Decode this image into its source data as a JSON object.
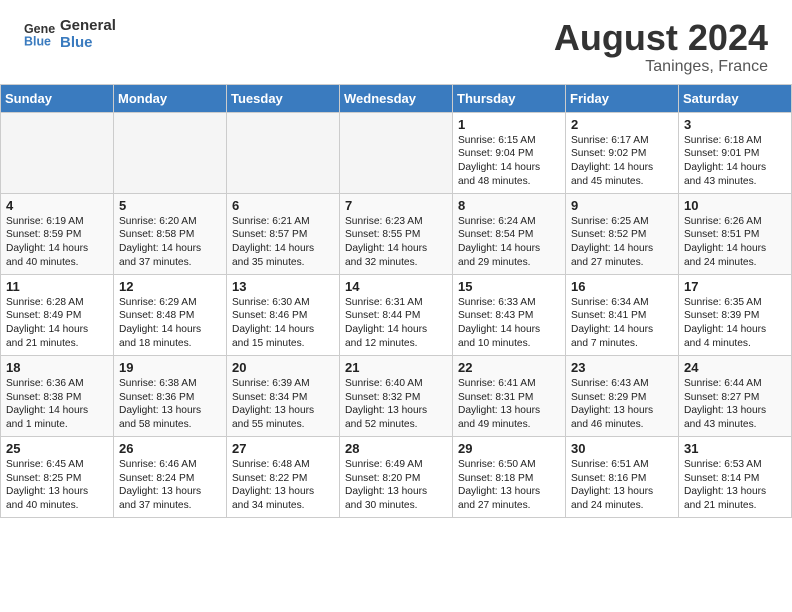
{
  "header": {
    "logo_line1": "General",
    "logo_line2": "Blue",
    "month_year": "August 2024",
    "location": "Taninges, France"
  },
  "days_of_week": [
    "Sunday",
    "Monday",
    "Tuesday",
    "Wednesday",
    "Thursday",
    "Friday",
    "Saturday"
  ],
  "weeks": [
    [
      {
        "day": "",
        "content": ""
      },
      {
        "day": "",
        "content": ""
      },
      {
        "day": "",
        "content": ""
      },
      {
        "day": "",
        "content": ""
      },
      {
        "day": "1",
        "content": "Sunrise: 6:15 AM\nSunset: 9:04 PM\nDaylight: 14 hours\nand 48 minutes."
      },
      {
        "day": "2",
        "content": "Sunrise: 6:17 AM\nSunset: 9:02 PM\nDaylight: 14 hours\nand 45 minutes."
      },
      {
        "day": "3",
        "content": "Sunrise: 6:18 AM\nSunset: 9:01 PM\nDaylight: 14 hours\nand 43 minutes."
      }
    ],
    [
      {
        "day": "4",
        "content": "Sunrise: 6:19 AM\nSunset: 8:59 PM\nDaylight: 14 hours\nand 40 minutes."
      },
      {
        "day": "5",
        "content": "Sunrise: 6:20 AM\nSunset: 8:58 PM\nDaylight: 14 hours\nand 37 minutes."
      },
      {
        "day": "6",
        "content": "Sunrise: 6:21 AM\nSunset: 8:57 PM\nDaylight: 14 hours\nand 35 minutes."
      },
      {
        "day": "7",
        "content": "Sunrise: 6:23 AM\nSunset: 8:55 PM\nDaylight: 14 hours\nand 32 minutes."
      },
      {
        "day": "8",
        "content": "Sunrise: 6:24 AM\nSunset: 8:54 PM\nDaylight: 14 hours\nand 29 minutes."
      },
      {
        "day": "9",
        "content": "Sunrise: 6:25 AM\nSunset: 8:52 PM\nDaylight: 14 hours\nand 27 minutes."
      },
      {
        "day": "10",
        "content": "Sunrise: 6:26 AM\nSunset: 8:51 PM\nDaylight: 14 hours\nand 24 minutes."
      }
    ],
    [
      {
        "day": "11",
        "content": "Sunrise: 6:28 AM\nSunset: 8:49 PM\nDaylight: 14 hours\nand 21 minutes."
      },
      {
        "day": "12",
        "content": "Sunrise: 6:29 AM\nSunset: 8:48 PM\nDaylight: 14 hours\nand 18 minutes."
      },
      {
        "day": "13",
        "content": "Sunrise: 6:30 AM\nSunset: 8:46 PM\nDaylight: 14 hours\nand 15 minutes."
      },
      {
        "day": "14",
        "content": "Sunrise: 6:31 AM\nSunset: 8:44 PM\nDaylight: 14 hours\nand 12 minutes."
      },
      {
        "day": "15",
        "content": "Sunrise: 6:33 AM\nSunset: 8:43 PM\nDaylight: 14 hours\nand 10 minutes."
      },
      {
        "day": "16",
        "content": "Sunrise: 6:34 AM\nSunset: 8:41 PM\nDaylight: 14 hours\nand 7 minutes."
      },
      {
        "day": "17",
        "content": "Sunrise: 6:35 AM\nSunset: 8:39 PM\nDaylight: 14 hours\nand 4 minutes."
      }
    ],
    [
      {
        "day": "18",
        "content": "Sunrise: 6:36 AM\nSunset: 8:38 PM\nDaylight: 14 hours\nand 1 minute."
      },
      {
        "day": "19",
        "content": "Sunrise: 6:38 AM\nSunset: 8:36 PM\nDaylight: 13 hours\nand 58 minutes."
      },
      {
        "day": "20",
        "content": "Sunrise: 6:39 AM\nSunset: 8:34 PM\nDaylight: 13 hours\nand 55 minutes."
      },
      {
        "day": "21",
        "content": "Sunrise: 6:40 AM\nSunset: 8:32 PM\nDaylight: 13 hours\nand 52 minutes."
      },
      {
        "day": "22",
        "content": "Sunrise: 6:41 AM\nSunset: 8:31 PM\nDaylight: 13 hours\nand 49 minutes."
      },
      {
        "day": "23",
        "content": "Sunrise: 6:43 AM\nSunset: 8:29 PM\nDaylight: 13 hours\nand 46 minutes."
      },
      {
        "day": "24",
        "content": "Sunrise: 6:44 AM\nSunset: 8:27 PM\nDaylight: 13 hours\nand 43 minutes."
      }
    ],
    [
      {
        "day": "25",
        "content": "Sunrise: 6:45 AM\nSunset: 8:25 PM\nDaylight: 13 hours\nand 40 minutes."
      },
      {
        "day": "26",
        "content": "Sunrise: 6:46 AM\nSunset: 8:24 PM\nDaylight: 13 hours\nand 37 minutes."
      },
      {
        "day": "27",
        "content": "Sunrise: 6:48 AM\nSunset: 8:22 PM\nDaylight: 13 hours\nand 34 minutes."
      },
      {
        "day": "28",
        "content": "Sunrise: 6:49 AM\nSunset: 8:20 PM\nDaylight: 13 hours\nand 30 minutes."
      },
      {
        "day": "29",
        "content": "Sunrise: 6:50 AM\nSunset: 8:18 PM\nDaylight: 13 hours\nand 27 minutes."
      },
      {
        "day": "30",
        "content": "Sunrise: 6:51 AM\nSunset: 8:16 PM\nDaylight: 13 hours\nand 24 minutes."
      },
      {
        "day": "31",
        "content": "Sunrise: 6:53 AM\nSunset: 8:14 PM\nDaylight: 13 hours\nand 21 minutes."
      }
    ]
  ]
}
